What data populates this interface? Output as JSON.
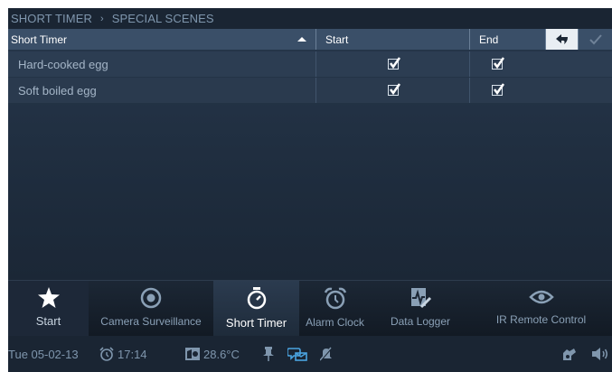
{
  "breadcrumb": {
    "parent": "SHORT TIMER",
    "separator": "›",
    "current": "SPECIAL SCENES"
  },
  "table": {
    "columns": {
      "name": "Short Timer",
      "start": "Start",
      "end": "End"
    },
    "rows": [
      {
        "name": "Hard-cooked egg",
        "start": true,
        "end": true
      },
      {
        "name": "Soft boiled egg",
        "start": true,
        "end": true
      }
    ]
  },
  "dock": {
    "items": [
      {
        "label": "Start",
        "icon": "star-icon"
      },
      {
        "label": "Camera Surveillance",
        "icon": "camera-icon"
      },
      {
        "label": "Short Timer",
        "icon": "stopwatch-icon",
        "active": true
      },
      {
        "label": "Alarm Clock",
        "icon": "alarm-clock-icon"
      },
      {
        "label": "Data Logger",
        "icon": "data-logger-icon"
      },
      {
        "label": "IR Remote Control",
        "icon": "eye-icon"
      }
    ]
  },
  "status": {
    "date": "Tue 05-02-13",
    "time": "17:14",
    "temperature": "28.6°C"
  },
  "colors": {
    "accent_blue": "#4aa3e0",
    "header_bg": "#3a4f68",
    "screen_bg": "#1b2634"
  }
}
